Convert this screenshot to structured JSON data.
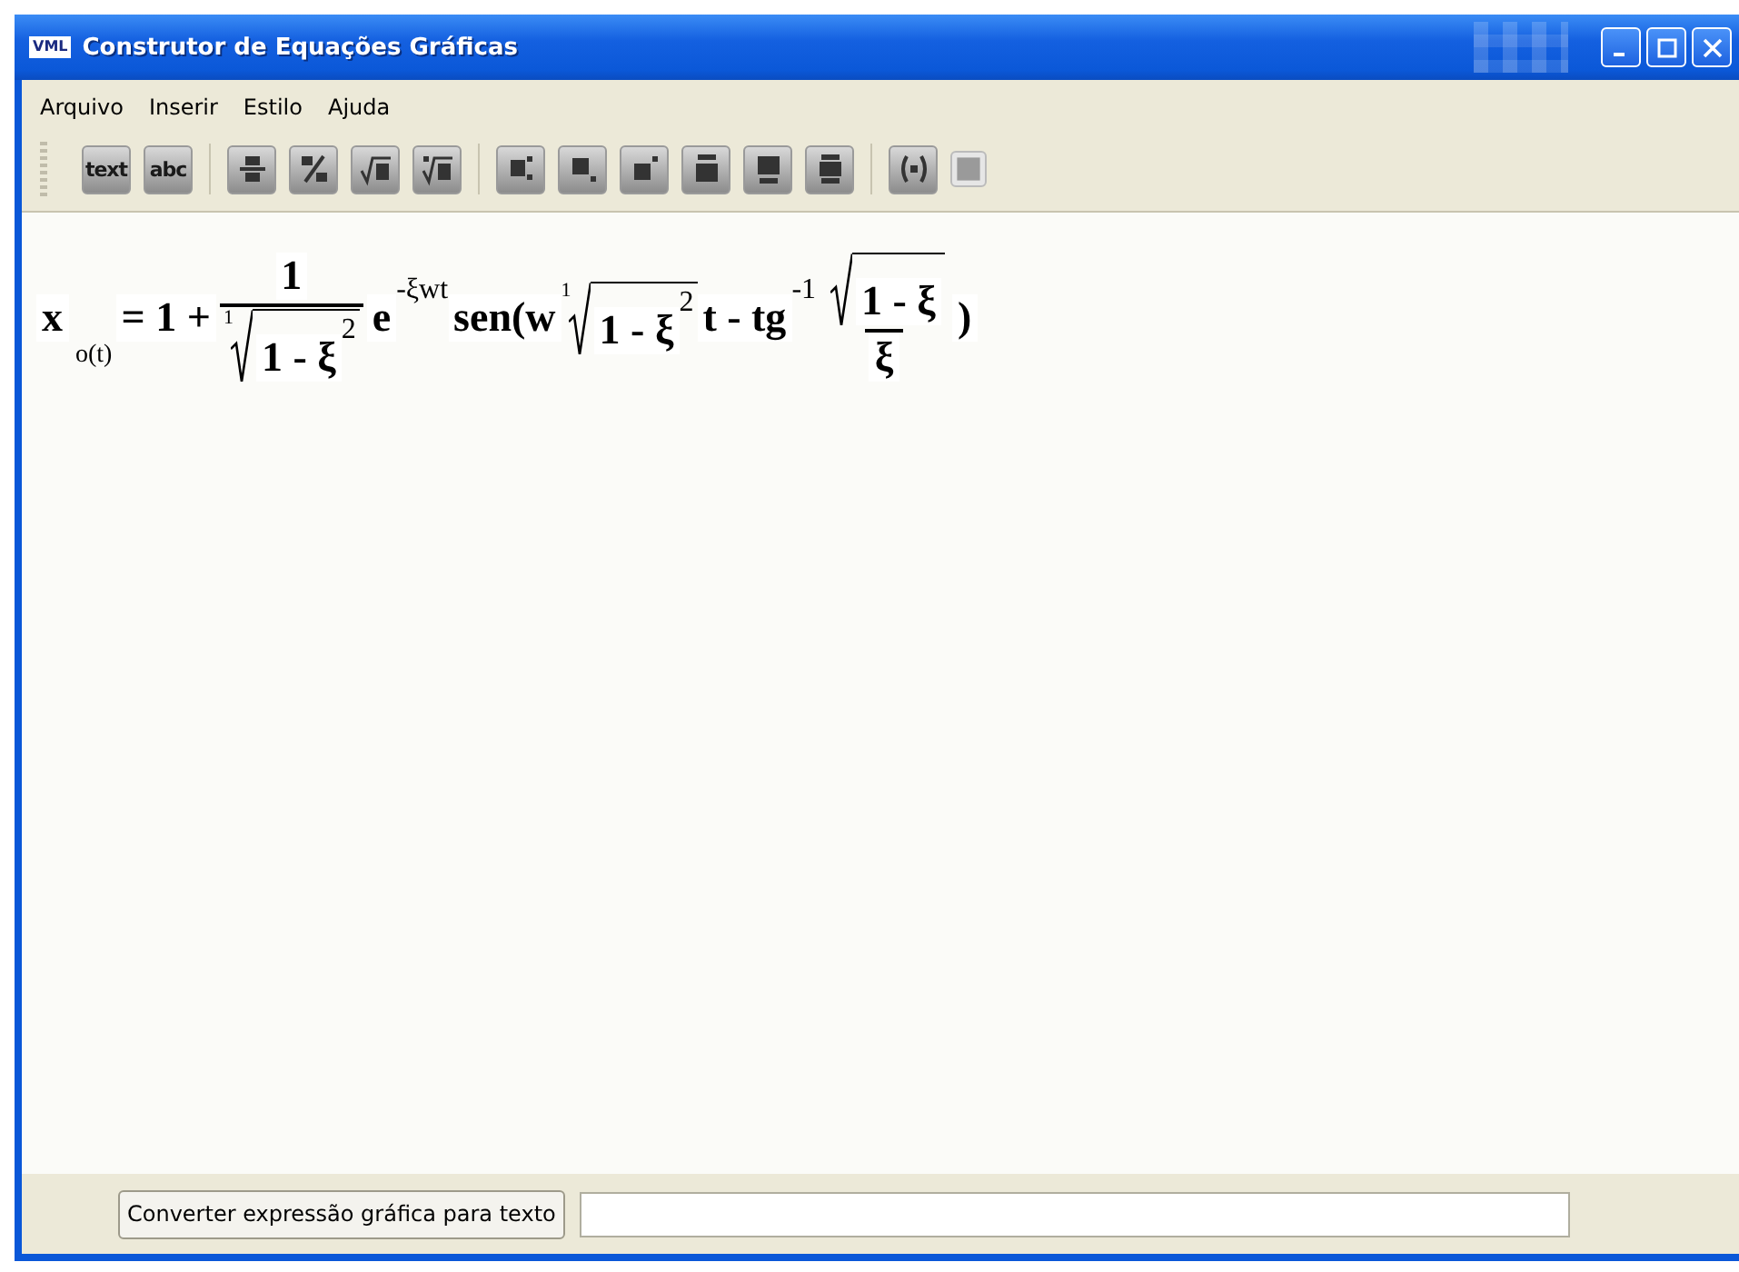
{
  "window": {
    "logo": "VML",
    "title": "Construtor de Equações Gráficas"
  },
  "menu": [
    "Arquivo",
    "Inserir",
    "Estilo",
    "Ajuda"
  ],
  "toolbar": [
    [
      {
        "kind": "text",
        "label": "text"
      },
      {
        "kind": "text",
        "label": "abc"
      }
    ],
    [
      {
        "kind": "fraction"
      },
      {
        "kind": "slash"
      },
      {
        "kind": "sqrt"
      },
      {
        "kind": "root"
      }
    ],
    [
      {
        "kind": "sub_right"
      },
      {
        "kind": "sub_low"
      },
      {
        "kind": "sup_right"
      },
      {
        "kind": "over"
      },
      {
        "kind": "under"
      },
      {
        "kind": "overunder"
      }
    ],
    [
      {
        "kind": "parens"
      },
      {
        "kind": "box"
      }
    ]
  ],
  "equation": [
    {
      "kind": "text",
      "text": "x"
    },
    {
      "kind": "sub",
      "text": "o(t)"
    },
    {
      "kind": "text",
      "text": "= 1 +"
    },
    {
      "kind": "frac",
      "num": [
        {
          "kind": "text",
          "text": "1"
        }
      ],
      "den": [
        {
          "kind": "sqrt",
          "index": "1",
          "body": [
            {
              "kind": "text",
              "text": "1 - ξ"
            },
            {
              "kind": "sup",
              "text": "2"
            }
          ]
        }
      ]
    },
    {
      "kind": "text",
      "text": "e"
    },
    {
      "kind": "sup",
      "text": "-ξwt"
    },
    {
      "kind": "text",
      "text": "sen(w"
    },
    {
      "kind": "sqrt",
      "index": "1",
      "body": [
        {
          "kind": "text",
          "text": "1 - ξ"
        },
        {
          "kind": "sup",
          "text": "2"
        }
      ]
    },
    {
      "kind": "text",
      "text": "t - tg"
    },
    {
      "kind": "sup",
      "text": "-1"
    },
    {
      "kind": "frac",
      "num": [
        {
          "kind": "sqrt",
          "body": [
            {
              "kind": "text",
              "text": "1 - ξ"
            }
          ]
        }
      ],
      "den": [
        {
          "kind": "text",
          "text": "ξ"
        }
      ]
    },
    {
      "kind": "text",
      "text": ")"
    }
  ],
  "convert_button": "Converter expressão gráfica para texto"
}
